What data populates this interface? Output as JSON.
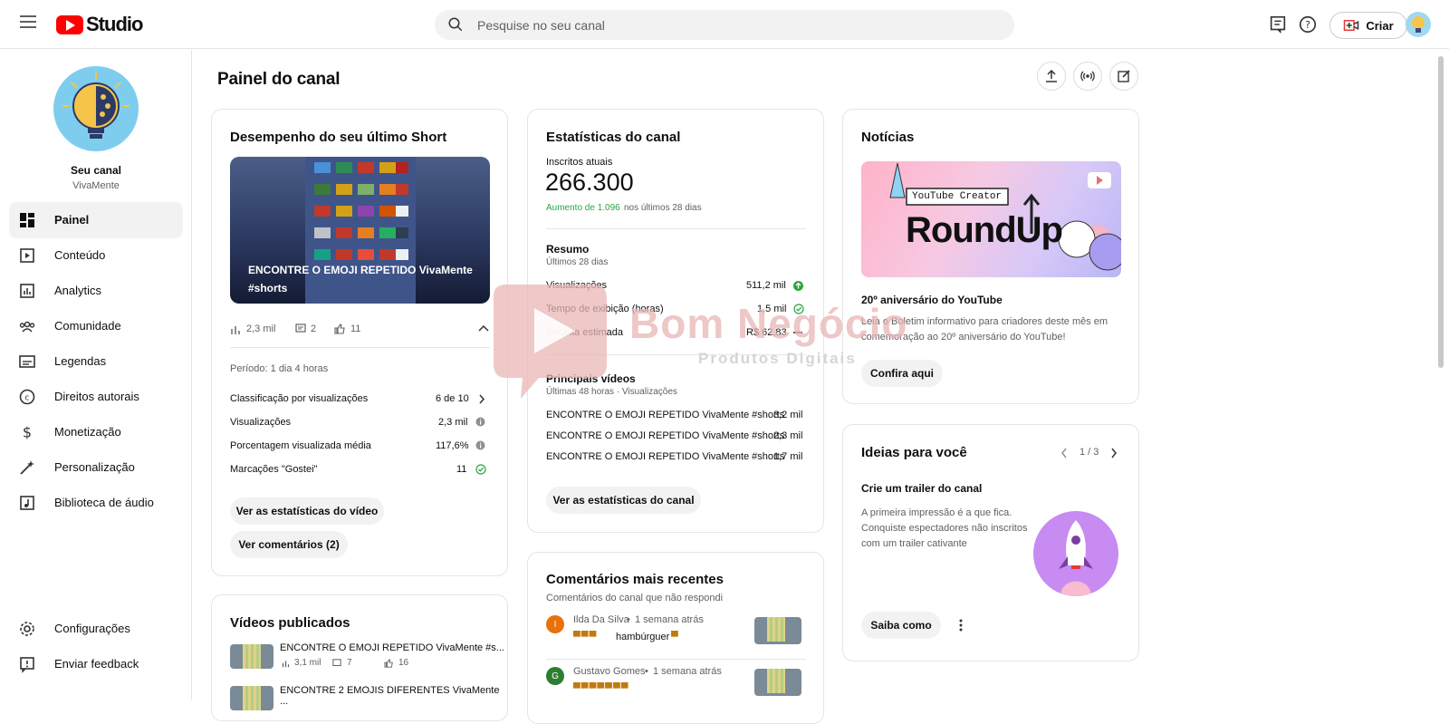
{
  "app": {
    "logo_text": "Studio",
    "brand_color": "#ff0000"
  },
  "topbar": {
    "search_placeholder": "Pesquise no seu canal",
    "create_label": "Criar"
  },
  "sidebar": {
    "channel_title": "Seu canal",
    "channel_name": "VivaMente",
    "items": [
      {
        "label": "Painel",
        "icon": "dashboard-icon",
        "active": true
      },
      {
        "label": "Conteúdo",
        "icon": "content-icon"
      },
      {
        "label": "Analytics",
        "icon": "analytics-icon"
      },
      {
        "label": "Comunidade",
        "icon": "community-icon"
      },
      {
        "label": "Legendas",
        "icon": "subtitles-icon"
      },
      {
        "label": "Direitos autorais",
        "icon": "copyright-icon"
      },
      {
        "label": "Monetização",
        "icon": "monetization-icon"
      },
      {
        "label": "Personalização",
        "icon": "customization-icon"
      },
      {
        "label": "Biblioteca de áudio",
        "icon": "audio-library-icon"
      }
    ],
    "bottom": [
      {
        "label": "Configurações",
        "icon": "gear-icon"
      },
      {
        "label": "Enviar feedback",
        "icon": "feedback-icon"
      }
    ]
  },
  "page": {
    "title": "Painel do canal"
  },
  "short": {
    "title": "Desempenho do seu último Short",
    "thumb_title": "ENCONTRE O EMOJI REPETIDO VivaMente #shorts",
    "views": "2,3 mil",
    "comments": "2",
    "likes": "11",
    "period": "Período: 1 dia 4 horas",
    "rows": [
      {
        "label": "Classificação por visualizações",
        "value": "6 de 10"
      },
      {
        "label": "Visualizações",
        "value": "2,3 mil"
      },
      {
        "label": "Porcentagem visualizada média",
        "value": "117,6%"
      },
      {
        "label": "Marcações \"Gostei\"",
        "value": "11"
      }
    ],
    "btn_stats": "Ver as estatísticas do vídeo",
    "btn_comments": "Ver comentários (2)"
  },
  "published": {
    "title": "Vídeos publicados",
    "videos": [
      {
        "title": "ENCONTRE O EMOJI REPETIDO VivaMente #s...",
        "views": "3,1 mil",
        "comments": "7",
        "likes": "16"
      },
      {
        "title": "ENCONTRE 2 EMOJIS DIFERENTES VivaMente ..."
      }
    ]
  },
  "stats": {
    "title": "Estatísticas do canal",
    "subs_label": "Inscritos atuais",
    "subs_value": "266.300",
    "increase": "Aumento de 1.096",
    "increase_suffix": "nos últimos 28 dias",
    "summary_title": "Resumo",
    "summary_period": "Últimos 28 dias",
    "summary_rows": [
      {
        "label": "Visualizações",
        "value": "511,2 mil"
      },
      {
        "label": "Tempo de exibição (horas)",
        "value": "1,5 mil"
      },
      {
        "label": "Receita estimada",
        "value": "R$ 62,83"
      }
    ],
    "top_title": "Principais vídeos",
    "top_period": "Últimas 48 horas · Visualizações",
    "top_videos": [
      {
        "title": "ENCONTRE O EMOJI REPETIDO VivaMente #shorts",
        "views": "3,2 mil"
      },
      {
        "title": "ENCONTRE O EMOJI REPETIDO VivaMente #shorts",
        "views": "2,3 mil"
      },
      {
        "title": "ENCONTRE O EMOJI REPETIDO VivaMente #shorts",
        "views": "1,7 mil"
      }
    ],
    "btn": "Ver as estatísticas do canal",
    "positive_color": "#2ba640"
  },
  "comments": {
    "title": "Comentários mais recentes",
    "subtitle": "Comentários do canal que não respondi",
    "items": [
      {
        "author": "Ilda Da Silva",
        "time": "1 semana atrás",
        "text": "hambúrguer",
        "initial": "I",
        "color": "#e8710a"
      },
      {
        "author": "Gustavo Gomes",
        "time": "1 semana atrás",
        "initial": "G",
        "color": "#2e7d32"
      }
    ]
  },
  "news": {
    "title": "Notícias",
    "banner_tag": "YouTube Creator",
    "banner_title": "RoundUp",
    "headline": "20º aniversário do YouTube",
    "body": "Leia o Boletim informativo para criadores deste mês em comemoração ao 20º aniversário do YouTube!",
    "btn": "Confira aqui"
  },
  "ideas": {
    "title": "Ideias para você",
    "pager": "1 / 3",
    "headline": "Crie um trailer do canal",
    "body": "A primeira impressão é a que fica. Conquiste espectadores não inscritos com um trailer cativante",
    "btn": "Saiba como"
  },
  "watermark": {
    "line1": "Bom Negócio",
    "line2": "Produtos Digitais"
  }
}
